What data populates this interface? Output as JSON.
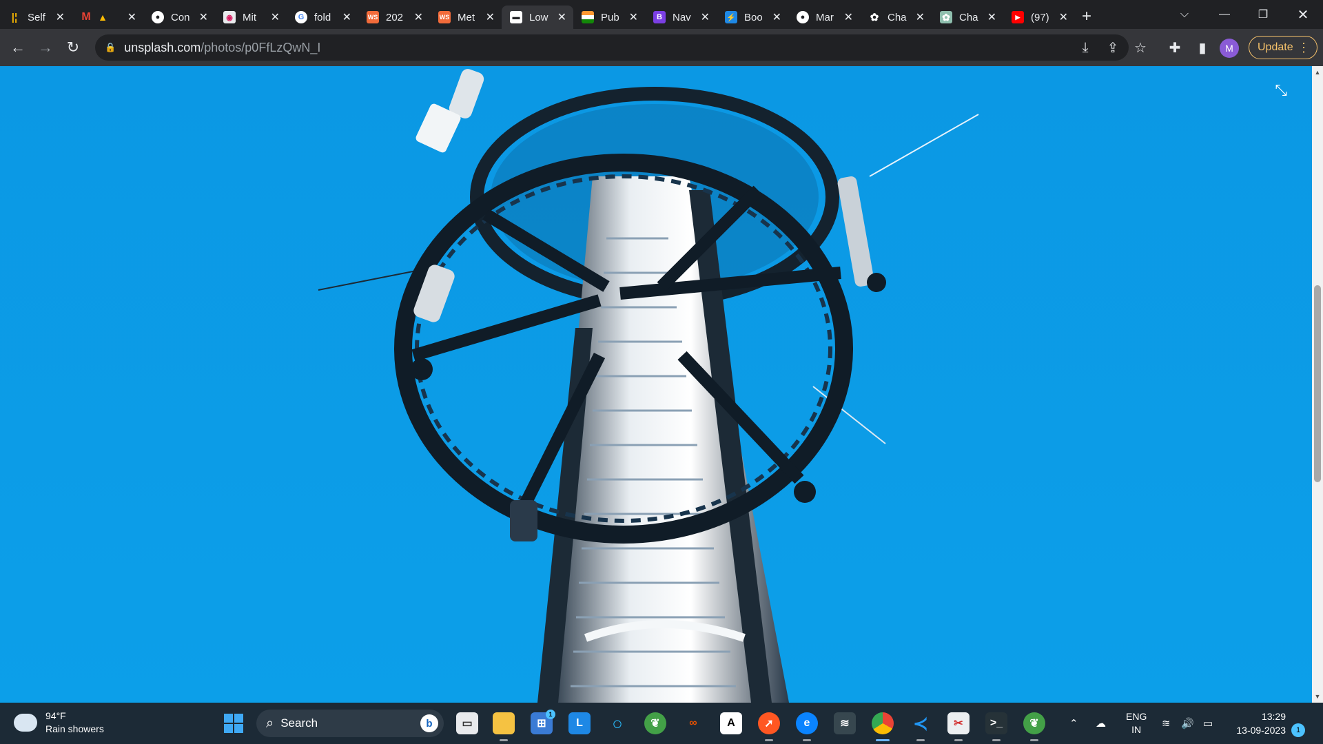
{
  "tabs": [
    {
      "title": "Self",
      "icon": "chart-bars-icon",
      "color": "#f5b400"
    },
    {
      "title": "M",
      "icon": "gmail-icon",
      "color": "#ea4335"
    },
    {
      "title": "Con",
      "icon": "github-icon",
      "color": "#ffffff"
    },
    {
      "title": "Mit",
      "icon": "meet-icon",
      "color": "#e8eaed"
    },
    {
      "title": "fold",
      "icon": "google-icon",
      "color": "#ffffff"
    },
    {
      "title": "202",
      "icon": "ws-icon",
      "color": "#f26b3a"
    },
    {
      "title": "Met",
      "icon": "ws-icon",
      "color": "#f26b3a"
    },
    {
      "title": "Low",
      "icon": "unsplash-icon",
      "color": "#ffffff",
      "active": true
    },
    {
      "title": "Pub",
      "icon": "india-flag-icon",
      "color": "#ff9933"
    },
    {
      "title": "Nav",
      "icon": "b-icon",
      "color": "#7b3fe4"
    },
    {
      "title": "Boo",
      "icon": "bolt-icon",
      "color": "#1e88e5"
    },
    {
      "title": "Mar",
      "icon": "github-icon",
      "color": "#ffffff"
    },
    {
      "title": "Cha",
      "icon": "openai-icon",
      "color": "#ffffff"
    },
    {
      "title": "Cha",
      "icon": "openai-icon",
      "color": "#19c37d"
    },
    {
      "title": "(97)",
      "icon": "youtube-icon",
      "color": "#ff0000"
    }
  ],
  "address": {
    "host": "unsplash.com",
    "path": "/photos/p0FfLzQwN_I"
  },
  "profile_initial": "M",
  "update_label": "Update",
  "weather": {
    "temp": "94°F",
    "desc": "Rain showers"
  },
  "search_label": "Search",
  "bing_label": "b",
  "taskbar_badge": "1",
  "tray": {
    "lang": "ENG",
    "region": "IN"
  },
  "clock": {
    "time": "13:29",
    "date": "13-09-2023"
  },
  "notif_count": "1",
  "colors": {
    "sky": "#0b9be6",
    "accent": "#f6c26b"
  }
}
